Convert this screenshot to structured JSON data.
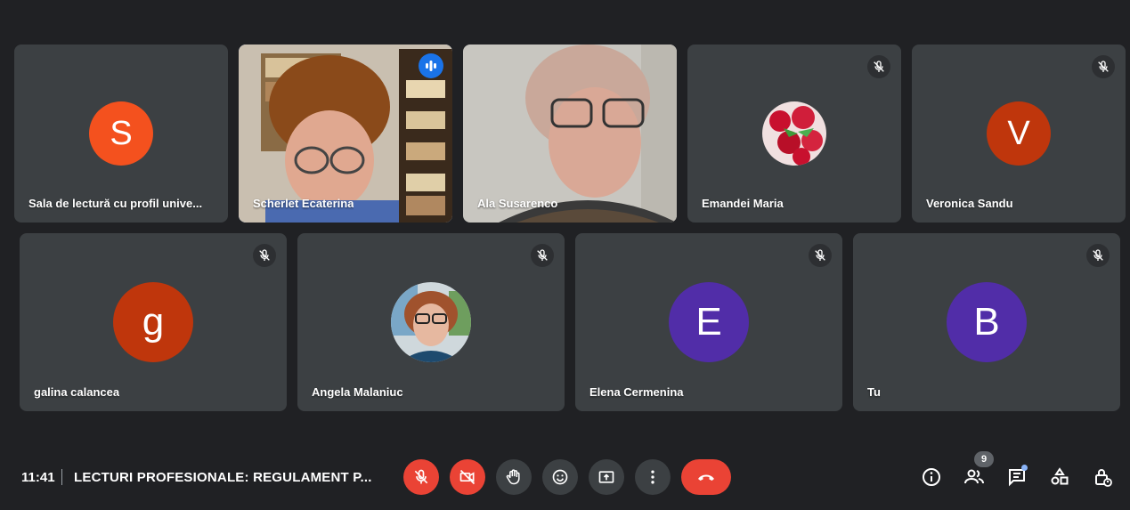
{
  "meeting": {
    "time": "11:41",
    "title": "LECTURI PROFESIONALE: REGULAMENT P...",
    "participants_count": "9"
  },
  "participants": [
    {
      "name": "Sala de lectură cu profil unive...",
      "initial": "S",
      "color": "#f4511e",
      "muted": false
    },
    {
      "name": "Scherlet Ecaterina",
      "speaking": true
    },
    {
      "name": "Ala Susarenco"
    },
    {
      "name": "Emandei Maria",
      "muted": true
    },
    {
      "name": "Veronica Sandu",
      "initial": "V",
      "color": "#bf360c",
      "muted": true
    },
    {
      "name": "galina calancea",
      "initial": "g",
      "color": "#bf360c",
      "muted": true
    },
    {
      "name": "Angela Malaniuc",
      "muted": true
    },
    {
      "name": "Elena Cermenina",
      "initial": "E",
      "color": "#512da8",
      "muted": true
    },
    {
      "name": "Tu",
      "initial": "B",
      "color": "#512da8",
      "muted": true
    }
  ],
  "controls": {
    "mic": "mic-off-icon",
    "camera": "camera-off-icon",
    "hand": "raise-hand-icon",
    "emoji": "emoji-icon",
    "present": "present-icon",
    "more": "more-icon",
    "hangup": "hangup-icon"
  },
  "colors": {
    "background": "#202124",
    "tile": "#3c4043",
    "danger": "#ea4335",
    "accent": "#8ab4f8"
  }
}
